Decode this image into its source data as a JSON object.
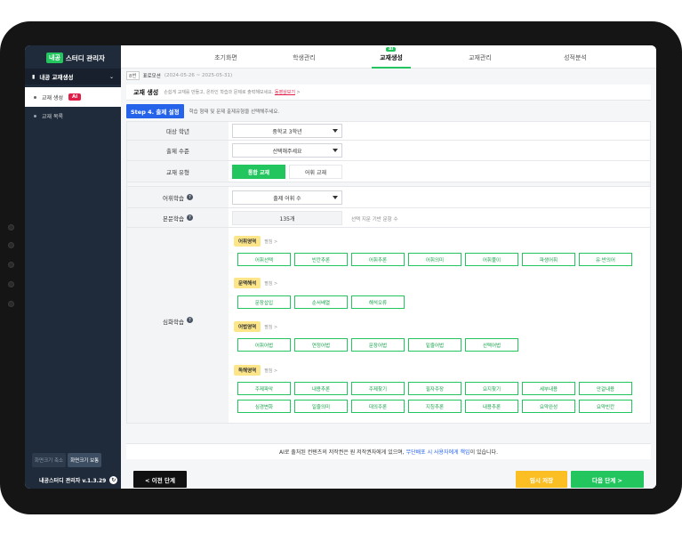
{
  "sidebar": {
    "logo_badge": "내공",
    "logo_text": "스터디 관리자",
    "section_title": "내공 교재생성",
    "active_item": "교재 생성",
    "active_badge": "AI",
    "second_item": "교재 목록",
    "size_small": "화면크기 축소",
    "size_normal": "화면크기 보통",
    "version": "내공스터디 관리자 v.1.3.29"
  },
  "topnav": {
    "tabs": [
      "초기화면",
      "학생관리",
      "교재생성",
      "교재관리",
      "성적분석"
    ],
    "active_tab": "교재생성",
    "ai_badge": "AI"
  },
  "breadcrumb": {
    "num": "8번",
    "name": "표로모션",
    "dates": "(2024-05-26 ~ 2025-05-31)"
  },
  "page_header": {
    "title": "교재 생성",
    "desc": "손쉽게 교재를 만들고, 온라인 학습과 문제로 출력해보세요.",
    "link": "동영상보기",
    "link_suffix": ">"
  },
  "step": {
    "label": "Step 4. 출제 설정",
    "desc": "학습 형태 및 문제 출제유형을 선택해주세요."
  },
  "form": {
    "grade_label": "대상 학년",
    "grade_value": "중학교 3학년",
    "level_label": "출제 수준",
    "level_value": "선택해주세요",
    "type_label": "교재 유형",
    "type_opt1": "통합 교재",
    "type_opt2": "어휘 교재",
    "vocab_label": "어휘학습",
    "vocab_value": "출제 어휘 수",
    "text_label": "본문학습",
    "text_value": "135개",
    "text_hint": "선택 지문 기반 문항 수",
    "deep_label": "심화학습",
    "more": "펼침 >",
    "categories": [
      {
        "name": "어휘영역",
        "chips": [
          "어휘선택",
          "빈칸추론",
          "어휘추론",
          "어휘의미",
          "어휘풀이",
          "파생어휘",
          "유·반의어"
        ]
      },
      {
        "name": "문맥해석",
        "chips": [
          "문장삽입",
          "순서배열",
          "해석오류"
        ]
      },
      {
        "name": "어법영역",
        "chips": [
          "어휘어법",
          "연정어법",
          "문장어법",
          "밑줄어법",
          "선택어법"
        ]
      },
      {
        "name": "독해영역",
        "chips": [
          "주제파악",
          "내용추론",
          "주제찾기",
          "필자주장",
          "요지찾기",
          "세부내용",
          "안걸내용",
          "심경변화",
          "일줄의미",
          "대의주론",
          "지칭추론",
          "내용추론",
          "요약완성",
          "요약빈칸"
        ]
      }
    ]
  },
  "notice": {
    "before": "AI로 출처된 컨텐츠의 저작권은 원 저작권자에게 있으며,",
    "link": "무단배포 시 사용자에게 책임",
    "after": "이 있습니다."
  },
  "buttons": {
    "prev": "< 이전 단계",
    "save": "임시 저장",
    "next": "다음 단계 >"
  }
}
